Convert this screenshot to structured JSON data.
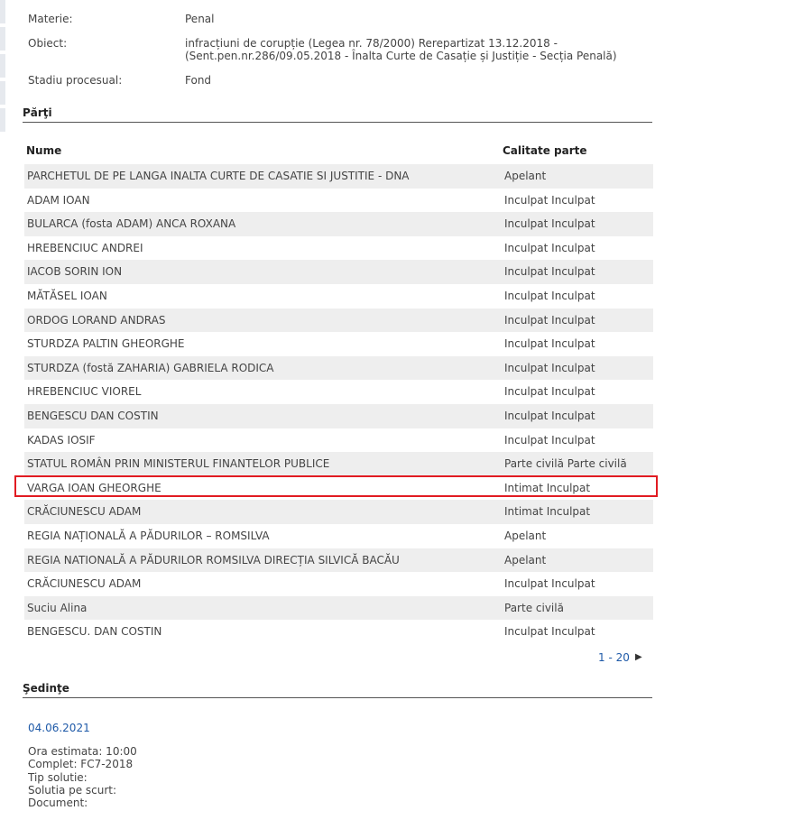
{
  "details": {
    "materie_label": "Materie:",
    "materie_value": "Penal",
    "obiect_label": "Obiect:",
    "obiect_value_line1": "infracțiuni de corupție (Legea nr. 78/2000) Rerepartizat 13.12.2018 -",
    "obiect_value_line2": "(Sent.pen.nr.286/09.05.2018 - Înalta Curte de Casație și Justiție - Secția Penală)",
    "stadiu_label": "Stadiu procesual:",
    "stadiu_value": "Fond"
  },
  "parti": {
    "title": "Părţi",
    "col_nume": "Nume",
    "col_calitate": "Calitate parte",
    "rows": [
      {
        "nume": "PARCHETUL DE PE LANGA INALTA CURTE DE CASATIE SI JUSTITIE - DNA",
        "calitate": "Apelant"
      },
      {
        "nume": "ADAM IOAN",
        "calitate": "Inculpat Inculpat"
      },
      {
        "nume": "BULARCA (fosta ADAM) ANCA ROXANA",
        "calitate": "Inculpat Inculpat"
      },
      {
        "nume": "HREBENCIUC ANDREI",
        "calitate": "Inculpat Inculpat"
      },
      {
        "nume": "IACOB SORIN ION",
        "calitate": "Inculpat Inculpat"
      },
      {
        "nume": "MĂTĂSEL IOAN",
        "calitate": "Inculpat Inculpat"
      },
      {
        "nume": "ORDOG LORAND ANDRAS",
        "calitate": "Inculpat Inculpat"
      },
      {
        "nume": "STURDZA PALTIN GHEORGHE",
        "calitate": "Inculpat Inculpat"
      },
      {
        "nume": "STURDZA (fostă ZAHARIA) GABRIELA RODICA",
        "calitate": "Inculpat Inculpat"
      },
      {
        "nume": "HREBENCIUC VIOREL",
        "calitate": "Inculpat Inculpat"
      },
      {
        "nume": "BENGESCU DAN COSTIN",
        "calitate": "Inculpat Inculpat"
      },
      {
        "nume": "KADAS IOSIF",
        "calitate": "Inculpat Inculpat"
      },
      {
        "nume": "STATUL ROMÂN PRIN MINISTERUL FINANTELOR PUBLICE",
        "calitate": "Parte civilă Parte civilă"
      },
      {
        "nume": "VARGA IOAN GHEORGHE",
        "calitate": "Intimat Inculpat"
      },
      {
        "nume": "CRĂCIUNESCU ADAM",
        "calitate": "Intimat Inculpat"
      },
      {
        "nume": "REGIA NAȚIONALĂ A PĂDURILOR – ROMSILVA",
        "calitate": "Apelant"
      },
      {
        "nume": "REGIA NATIONALĂ A PĂDURILOR ROMSILVA DIRECȚIA SILVICĂ BACĂU",
        "calitate": "Apelant"
      },
      {
        "nume": "CRĂCIUNESCU ADAM",
        "calitate": "Inculpat Inculpat"
      },
      {
        "nume": "Suciu Alina",
        "calitate": "Parte civilă"
      },
      {
        "nume": "BENGESCU. DAN COSTIN",
        "calitate": "Inculpat Inculpat"
      }
    ],
    "pager_text": "1 - 20",
    "pager_next_icon": "triangle-right-icon",
    "highlight_color": "#e11b22"
  },
  "sedinte": {
    "title": "Şedinţe",
    "date": "04.06.2021",
    "ora": "Ora estimata: 10:00",
    "complet": "Complet: FC7-2018",
    "tip_solutie": "Tip solutie:",
    "solutia_pe_scurt": "Solutia pe scurt:",
    "document": "Document:"
  },
  "colors": {
    "link": "#1f5aa8",
    "row_alt": "#eeeeee",
    "text": "#444444"
  }
}
